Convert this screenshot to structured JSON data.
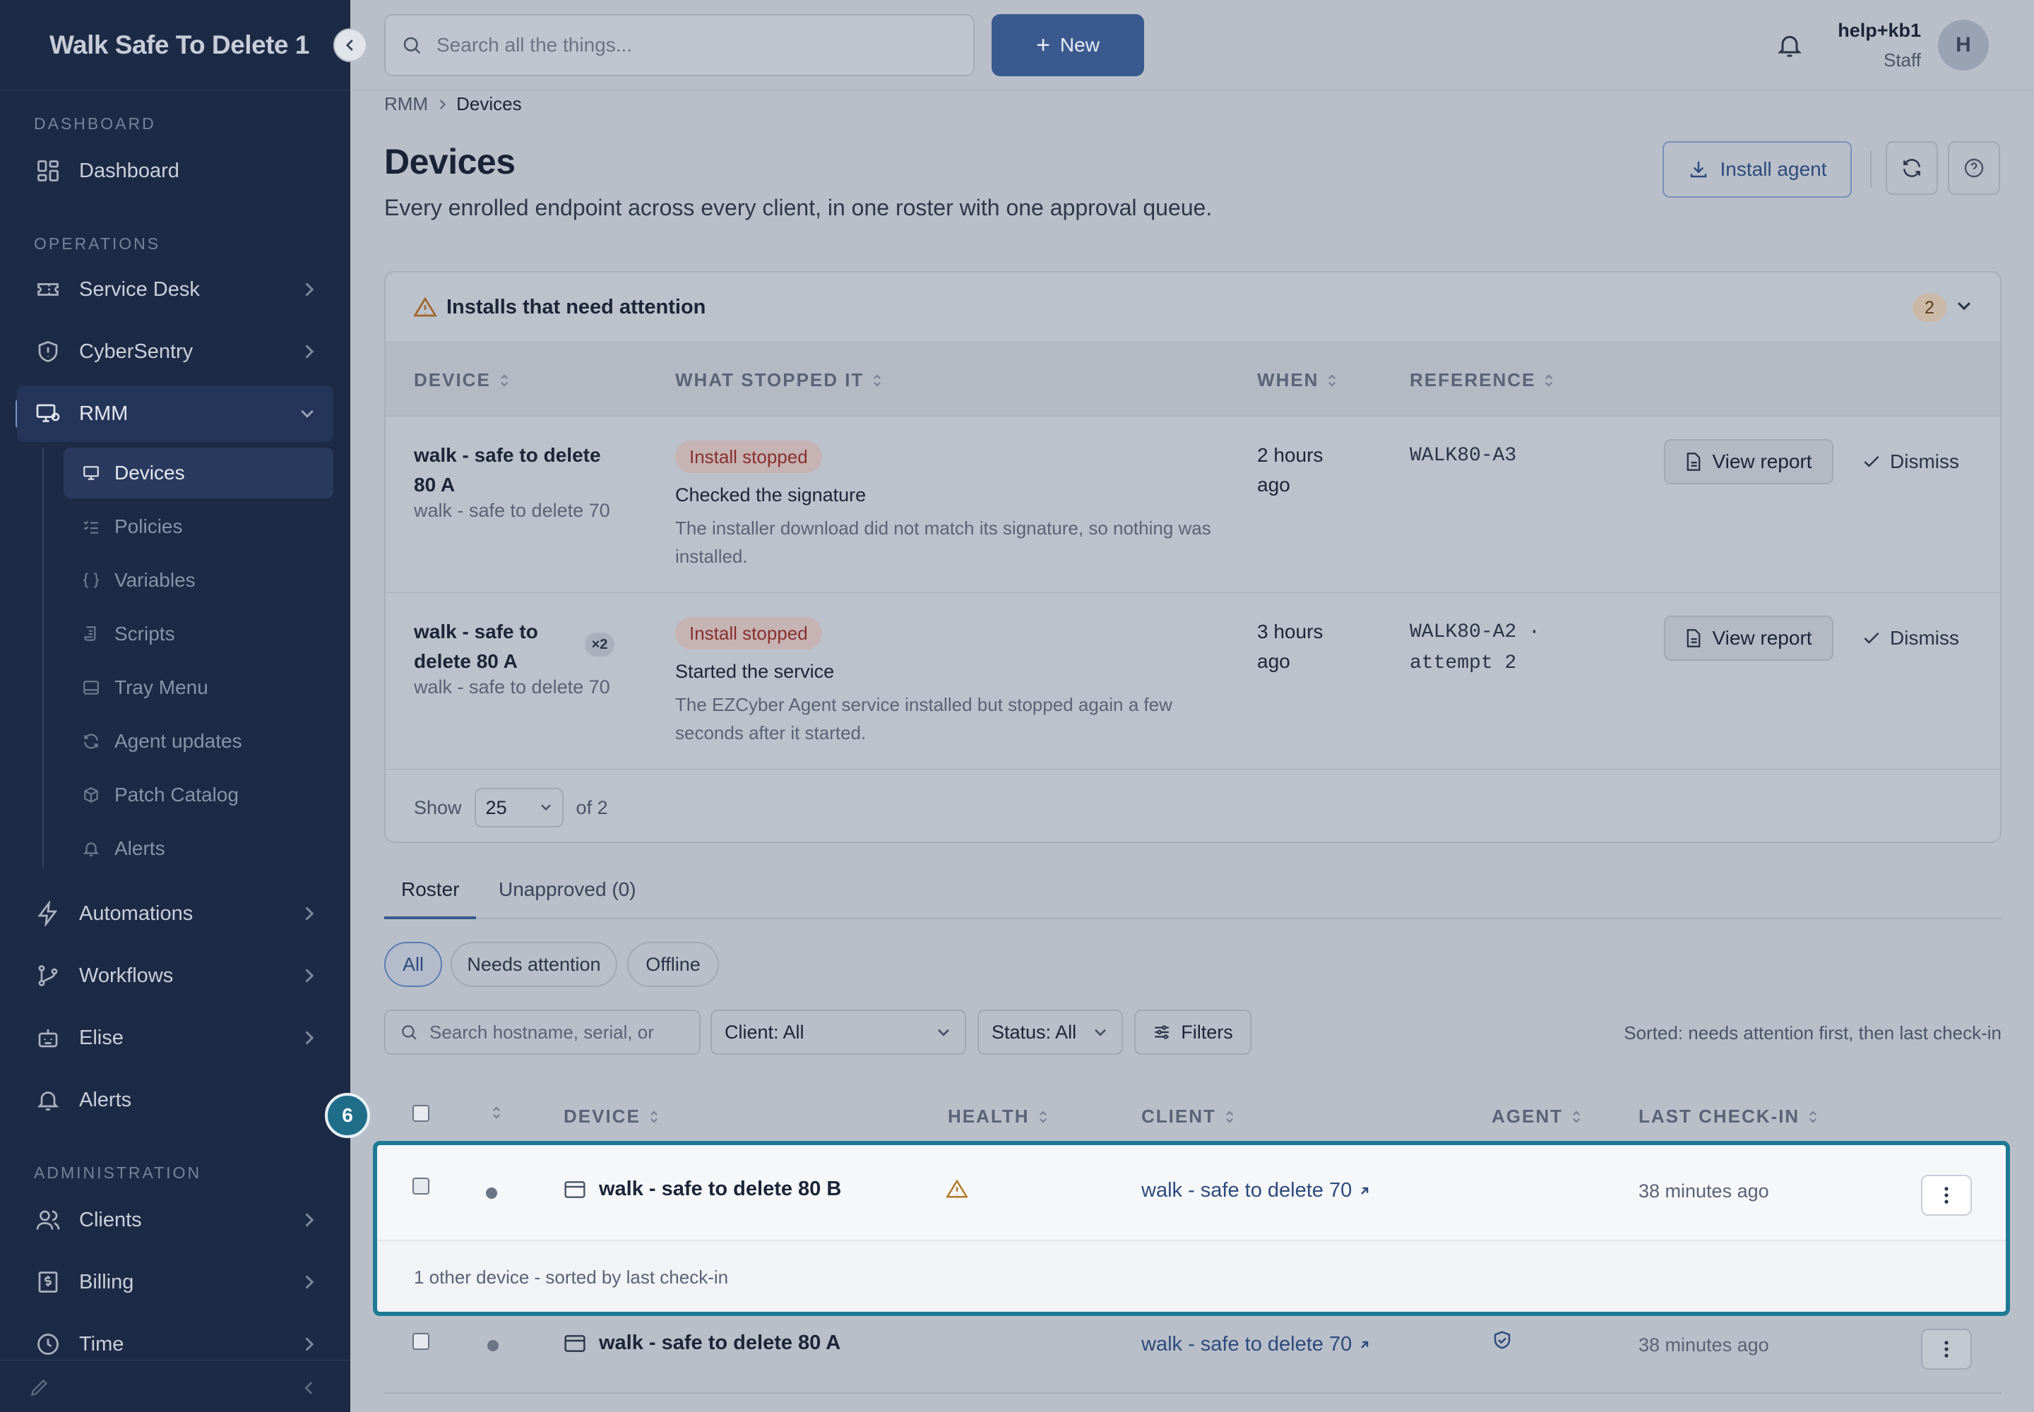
{
  "sidebar": {
    "brand": "Walk Safe To Delete 1",
    "sections": {
      "dashboard": "DASHBOARD",
      "operations": "OPERATIONS",
      "administration": "ADMINISTRATION"
    },
    "items": {
      "dashboard": "Dashboard",
      "service_desk": "Service Desk",
      "cybersentry": "CyberSentry",
      "rmm": "RMM",
      "automations": "Automations",
      "workflows": "Workflows",
      "elise": "Elise",
      "alerts": "Alerts",
      "clients": "Clients",
      "billing": "Billing",
      "time": "Time"
    },
    "rmm_sub": {
      "devices": "Devices",
      "policies": "Policies",
      "variables": "Variables",
      "scripts": "Scripts",
      "tray_menu": "Tray Menu",
      "agent_updates": "Agent updates",
      "patch_catalog": "Patch Catalog",
      "alerts": "Alerts"
    }
  },
  "topbar": {
    "search_placeholder": "Search all the things...",
    "new_label": "New",
    "user_name": "help+kb1",
    "user_role": "Staff",
    "avatar_initial": "H"
  },
  "breadcrumb": {
    "parent": "RMM",
    "current": "Devices"
  },
  "page": {
    "title": "Devices",
    "subtitle": "Every enrolled endpoint across every client, in one roster with one approval queue.",
    "install_agent": "Install agent"
  },
  "attention": {
    "title": "Installs that need attention",
    "count": "2",
    "columns": {
      "device": "DEVICE",
      "what": "WHAT STOPPED IT",
      "when": "WHEN",
      "reference": "REFERENCE"
    },
    "rows": [
      {
        "device": "walk - safe to delete 80 A",
        "client": "walk - safe to delete 70",
        "badge": "Install stopped",
        "step": "Checked the signature",
        "description": "The installer download did not match its signature, so nothing was installed.",
        "when": "2 hours ago",
        "reference": "WALK80-A3",
        "view": "View report",
        "dismiss": "Dismiss"
      },
      {
        "device": "walk - safe to delete 80 A",
        "repeat": "×2",
        "client": "walk - safe to delete 70",
        "badge": "Install stopped",
        "step": "Started the service",
        "description": "The EZCyber Agent service installed but stopped again a few seconds after it started.",
        "when": "3 hours ago",
        "reference": "WALK80-A2 · attempt 2",
        "view": "View report",
        "dismiss": "Dismiss"
      }
    ],
    "pager": {
      "show": "Show",
      "page_size": "25",
      "of": "of 2"
    }
  },
  "tabs": {
    "roster": "Roster",
    "unapproved": "Unapproved (0)"
  },
  "chips": {
    "all": "All",
    "needs_attention": "Needs attention",
    "offline": "Offline"
  },
  "filters": {
    "search_placeholder": "Search hostname, serial, or",
    "client": "Client: All",
    "status": "Status: All",
    "filters": "Filters",
    "sorted": "Sorted: needs attention first, then last check-in"
  },
  "roster": {
    "columns": {
      "device": "DEVICE",
      "health": "HEALTH",
      "client": "CLIENT",
      "agent": "AGENT",
      "last_checkin": "LAST CHECK-IN"
    },
    "step_number": "6",
    "rows": [
      {
        "device": "walk - safe to delete 80 B",
        "client": "walk - safe to delete 70",
        "checkin": "38 minutes ago",
        "group_note": "1 other device - sorted by last check-in"
      },
      {
        "device": "walk - safe to delete 80 A",
        "client": "walk - safe to delete 70",
        "checkin": "38 minutes ago"
      }
    ]
  }
}
